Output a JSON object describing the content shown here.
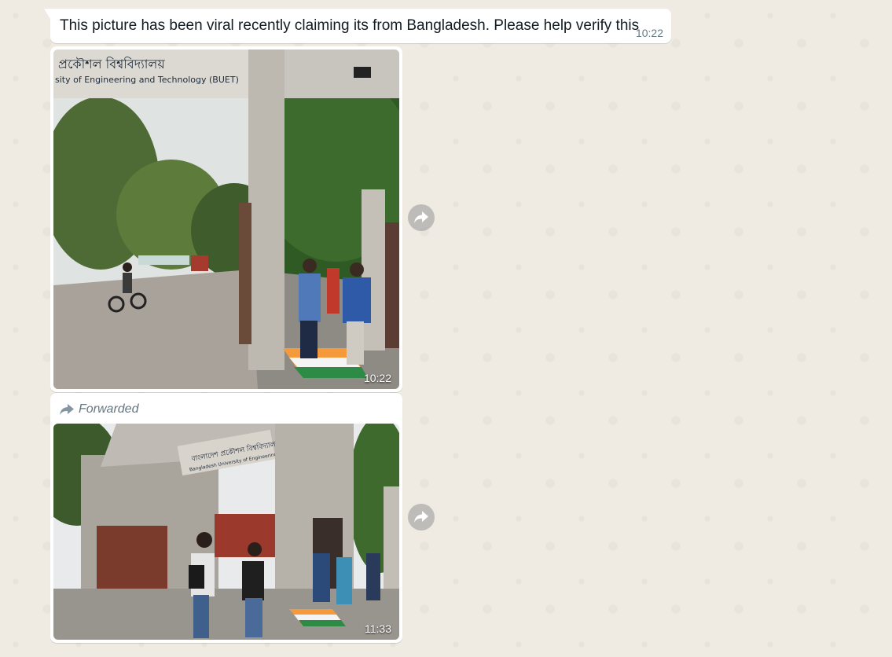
{
  "messages": [
    {
      "type": "text",
      "text": "This picture has been viral recently claiming its from Bangladesh. Please help verify this",
      "time": "10:22"
    },
    {
      "type": "image",
      "time": "10:22",
      "sign_bangla": "প্রকৌশল  বিশ্ববিদ্যালয়",
      "sign_english": "sity of Engineering and Technology (BUET)"
    },
    {
      "type": "image",
      "forwarded_label": "Forwarded",
      "time": "11:33",
      "sign_bangla": "বাংলাদেশ প্রকৌশল বিশ্ববিদ্যালয়",
      "sign_english": "Bangladesh University of Engineering and Technology"
    }
  ],
  "icons": {
    "share": "forward-share-icon",
    "forwarded": "forward-arrow-icon"
  },
  "colors": {
    "bubble": "#ffffff",
    "background": "#efeae2",
    "meta_text": "#667781"
  }
}
